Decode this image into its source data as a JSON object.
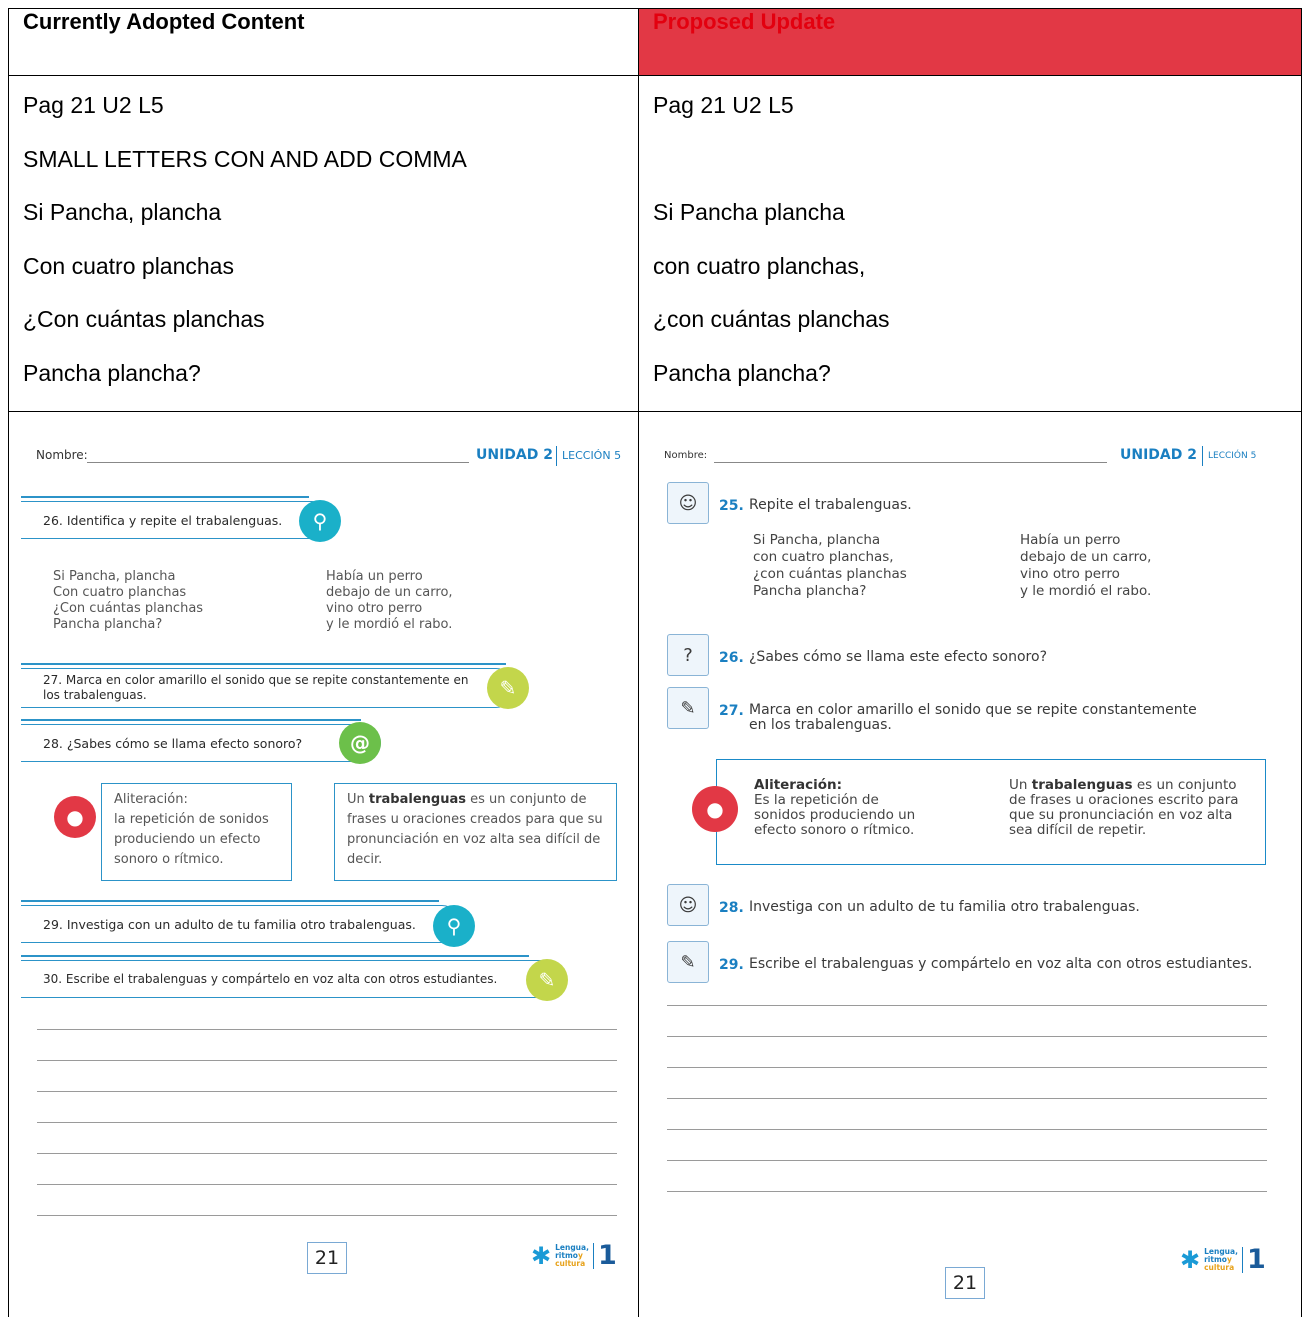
{
  "table": {
    "headers": {
      "current": "Currently Adopted Content",
      "proposed": "Proposed Update"
    },
    "current_lines": [
      "Pag 21 U2 L5",
      "SMALL LETTERS CON AND ADD COMMA",
      "Si Pancha, plancha",
      "Con cuatro planchas",
      "¿Con cuántas planchas",
      "Pancha plancha?"
    ],
    "proposed_lines": [
      "Pag 21 U2 L5",
      "",
      "Si Pancha plancha",
      "con cuatro planchas,",
      "¿con cuántas planchas",
      "Pancha plancha?"
    ]
  },
  "left_page": {
    "nombre": "Nombre:",
    "unidad": "UNIDAD 2",
    "leccion": "LECCIÓN 5",
    "q26": "26. Identifica y repite el trabalenguas.",
    "poem_left": "Si Pancha, plancha\nCon cuatro planchas\n¿Con cuántas planchas\nPancha plancha?",
    "poem_right": "Había un perro\ndebajo de un carro,\nvino otro perro\ny le mordió el rabo.",
    "q27": "27. Marca en color amarillo el sonido que se repite constantemente en los trabalenguas.",
    "q28": "28. ¿Sabes cómo se llama efecto sonoro?",
    "alit_title": "Aliteración:",
    "alit_text": "la repetición de sonidos produciendo un efecto sonoro o rítmico.",
    "trab_word": "trabalenguas",
    "trab_pre": "Un",
    "trab_post": "es un conjunto de frases u oraciones creados para que su pronunciación en voz alta sea difícil de decir.",
    "q29": "29. Investiga con un adulto de tu familia otro trabalenguas.",
    "q30": "30. Escribe el trabalenguas y compártelo en voz alta con otros estudiantes.",
    "page_number": "21",
    "logo": {
      "l1": "Lengua,",
      "l2": "ritmo",
      "l3": "y",
      "l4": "cultura",
      "grade": "1"
    }
  },
  "right_page": {
    "nombre": "Nombre:",
    "unidad": "UNIDAD 2",
    "leccion": "LECCIÓN 5",
    "q25_num": "25.",
    "q25": "Repite el trabalenguas.",
    "poem_left": "Si Pancha, plancha\ncon cuatro planchas,\n¿con cuántas planchas\nPancha plancha?",
    "poem_right": "Había un perro\ndebajo de un carro,\nvino otro perro\ny le mordió el rabo.",
    "q26_num": "26.",
    "q26": "¿Sabes cómo se llama este efecto sonoro?",
    "q27_num": "27.",
    "q27": "Marca en color amarillo el sonido que se repite constantemente\nen los trabalenguas.",
    "alit_title": "Aliteración:",
    "alit_text": "Es la repetición de\nsonidos produciendo un\nefecto sonoro o rítmico.",
    "trab_pre": "Un",
    "trab_word": "trabalenguas",
    "trab_post": "es un conjunto\nde frases u oraciones escrito para\nque su pronunciación en voz alta\nsea difícil de repetir.",
    "q28_num": "28.",
    "q28": "Investiga con un adulto de tu familia otro trabalenguas.",
    "q29_num": "29.",
    "q29": "Escribe el trabalenguas y compártelo en voz alta con otros estudiantes.",
    "page_number": "21",
    "logo": {
      "l1": "Lengua,",
      "l2": "ritmo",
      "l3": "y",
      "l4": "cultura",
      "grade": "1"
    }
  },
  "icons": {
    "magnifier": "search-icon",
    "pencil": "pencil-icon",
    "spiral": "spiral-icon",
    "lightbulb": "lightbulb-icon"
  },
  "colors": {
    "proposed_header": "#e3000f",
    "accent_blue": "#1a7fc1"
  }
}
